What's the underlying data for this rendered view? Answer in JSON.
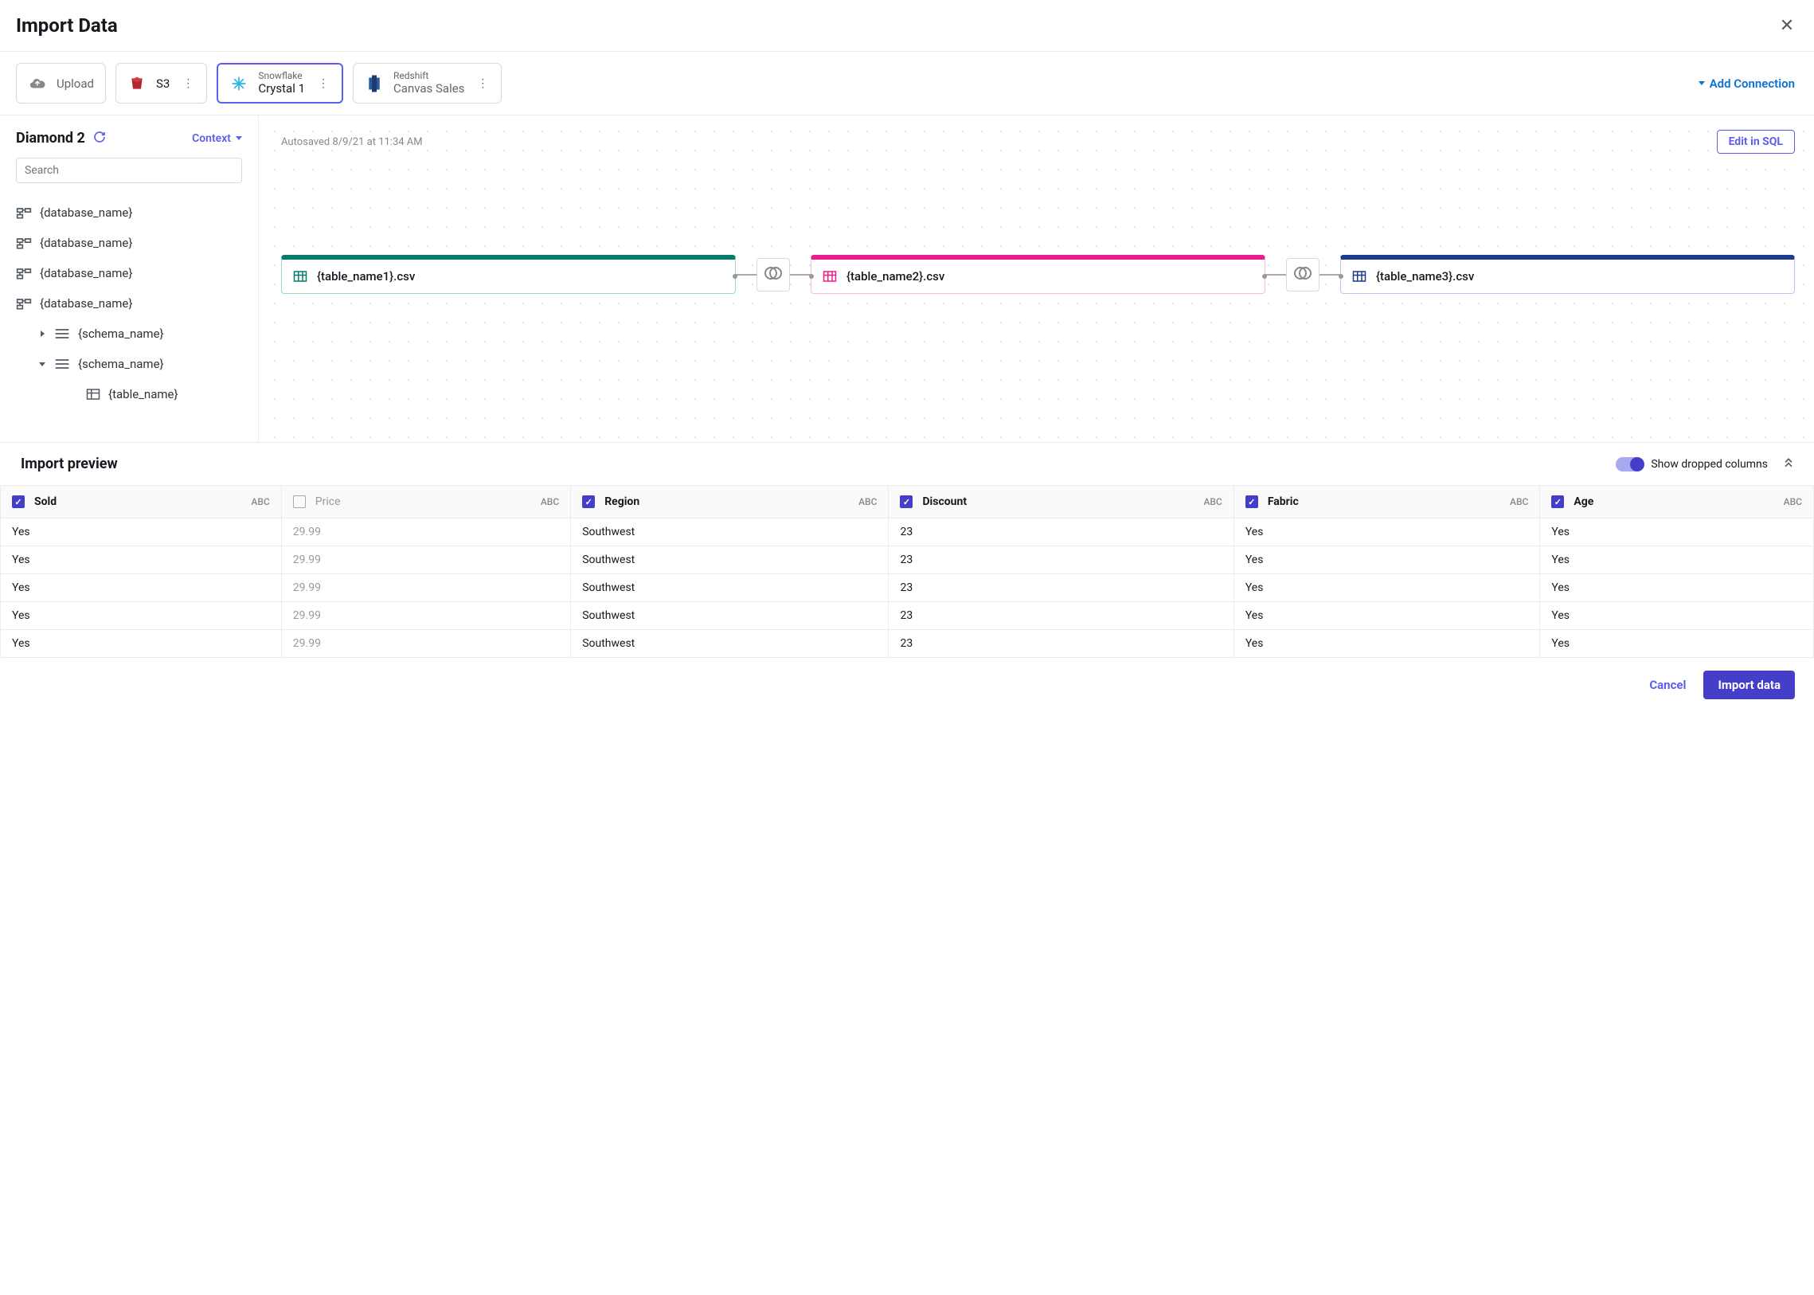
{
  "page_title": "Import Data",
  "sources": {
    "upload_label": "Upload",
    "s3": {
      "label": "S3"
    },
    "snowflake": {
      "top": "Snowflake",
      "label": "Crystal 1"
    },
    "redshift": {
      "top": "Redshift",
      "label": "Canvas Sales"
    }
  },
  "add_connection_label": "Add Connection",
  "sidebar": {
    "title": "Diamond 2",
    "context_label": "Context",
    "search_placeholder": "Search",
    "databases": [
      "{database_name}",
      "{database_name}",
      "{database_name}",
      "{database_name}"
    ],
    "schemas": [
      "{schema_name}",
      "{schema_name}"
    ],
    "table": "{table_name}"
  },
  "canvas": {
    "autosave": "Autosaved 8/9/21 at 11:34 AM",
    "edit_sql_label": "Edit in SQL",
    "nodes": {
      "n1": "{table_name1}.csv",
      "n2": "{table_name2}.csv",
      "n3": "{table_name3}.csv"
    }
  },
  "preview": {
    "title": "Import preview",
    "toggle_label": "Show dropped columns",
    "columns": [
      {
        "name": "Sold",
        "type": "ABC",
        "checked": true
      },
      {
        "name": "Price",
        "type": "ABC",
        "checked": false
      },
      {
        "name": "Region",
        "type": "ABC",
        "checked": true
      },
      {
        "name": "Discount",
        "type": "ABC",
        "checked": true
      },
      {
        "name": "Fabric",
        "type": "ABC",
        "checked": true
      },
      {
        "name": "Age",
        "type": "ABC",
        "checked": true
      }
    ],
    "rows": [
      {
        "Sold": "Yes",
        "Price": "29.99",
        "Region": "Southwest",
        "Discount": "23",
        "Fabric": "Yes",
        "Age": "Yes"
      },
      {
        "Sold": "Yes",
        "Price": "29.99",
        "Region": "Southwest",
        "Discount": "23",
        "Fabric": "Yes",
        "Age": "Yes"
      },
      {
        "Sold": "Yes",
        "Price": "29.99",
        "Region": "Southwest",
        "Discount": "23",
        "Fabric": "Yes",
        "Age": "Yes"
      },
      {
        "Sold": "Yes",
        "Price": "29.99",
        "Region": "Southwest",
        "Discount": "23",
        "Fabric": "Yes",
        "Age": "Yes"
      },
      {
        "Sold": "Yes",
        "Price": "29.99",
        "Region": "Southwest",
        "Discount": "23",
        "Fabric": "Yes",
        "Age": "Yes"
      }
    ]
  },
  "footer": {
    "cancel_label": "Cancel",
    "import_label": "Import data"
  }
}
